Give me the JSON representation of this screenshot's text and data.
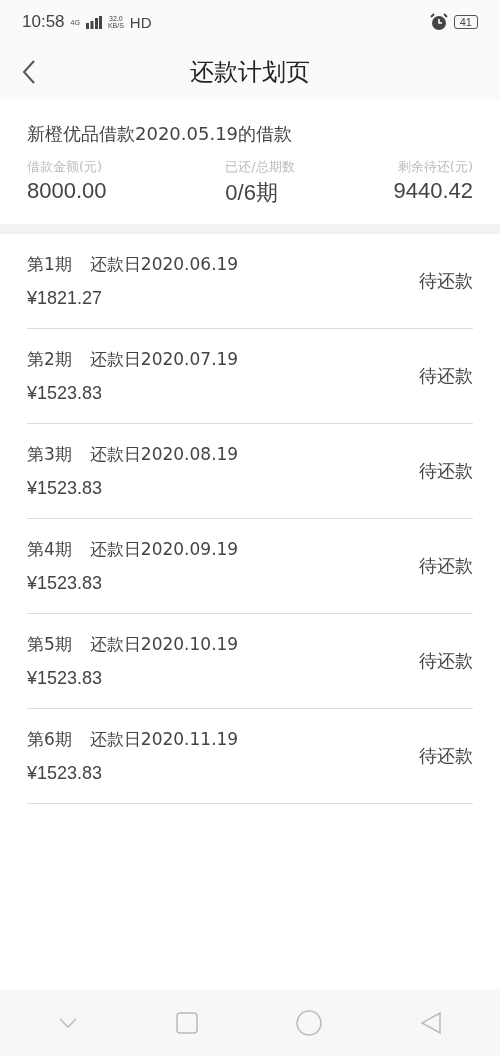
{
  "status_bar": {
    "time": "10:58",
    "network": "4G",
    "speed_value": "32.0",
    "speed_unit": "KB/S",
    "hd": "HD",
    "battery": "41"
  },
  "header": {
    "title": "还款计划页"
  },
  "summary": {
    "title": "新橙优品借款2020.05.19的借款",
    "stats": [
      {
        "label": "借款金额(元)",
        "value": "8000.00"
      },
      {
        "label": "已还/总期数",
        "value": "0/6期"
      },
      {
        "label": "剩余待还(元)",
        "value": "9440.42"
      }
    ]
  },
  "installments": [
    {
      "period": "第1期",
      "due_date": "还款日2020.06.19",
      "amount": "¥1821.27",
      "status": "待还款"
    },
    {
      "period": "第2期",
      "due_date": "还款日2020.07.19",
      "amount": "¥1523.83",
      "status": "待还款"
    },
    {
      "period": "第3期",
      "due_date": "还款日2020.08.19",
      "amount": "¥1523.83",
      "status": "待还款"
    },
    {
      "period": "第4期",
      "due_date": "还款日2020.09.19",
      "amount": "¥1523.83",
      "status": "待还款"
    },
    {
      "period": "第5期",
      "due_date": "还款日2020.10.19",
      "amount": "¥1523.83",
      "status": "待还款"
    },
    {
      "period": "第6期",
      "due_date": "还款日2020.11.19",
      "amount": "¥1523.83",
      "status": "待还款"
    }
  ]
}
